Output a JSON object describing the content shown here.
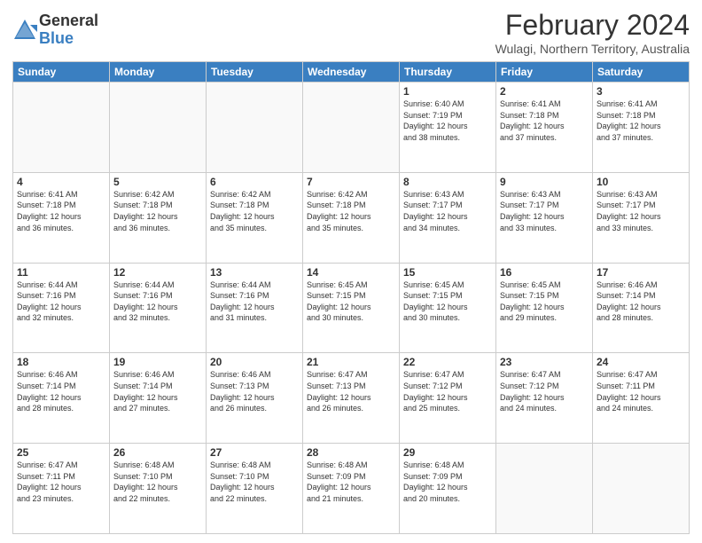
{
  "logo": {
    "general": "General",
    "blue": "Blue"
  },
  "title": "February 2024",
  "subtitle": "Wulagi, Northern Territory, Australia",
  "days_of_week": [
    "Sunday",
    "Monday",
    "Tuesday",
    "Wednesday",
    "Thursday",
    "Friday",
    "Saturday"
  ],
  "weeks": [
    [
      {
        "day": "",
        "info": ""
      },
      {
        "day": "",
        "info": ""
      },
      {
        "day": "",
        "info": ""
      },
      {
        "day": "",
        "info": ""
      },
      {
        "day": "1",
        "info": "Sunrise: 6:40 AM\nSunset: 7:19 PM\nDaylight: 12 hours\nand 38 minutes."
      },
      {
        "day": "2",
        "info": "Sunrise: 6:41 AM\nSunset: 7:18 PM\nDaylight: 12 hours\nand 37 minutes."
      },
      {
        "day": "3",
        "info": "Sunrise: 6:41 AM\nSunset: 7:18 PM\nDaylight: 12 hours\nand 37 minutes."
      }
    ],
    [
      {
        "day": "4",
        "info": "Sunrise: 6:41 AM\nSunset: 7:18 PM\nDaylight: 12 hours\nand 36 minutes."
      },
      {
        "day": "5",
        "info": "Sunrise: 6:42 AM\nSunset: 7:18 PM\nDaylight: 12 hours\nand 36 minutes."
      },
      {
        "day": "6",
        "info": "Sunrise: 6:42 AM\nSunset: 7:18 PM\nDaylight: 12 hours\nand 35 minutes."
      },
      {
        "day": "7",
        "info": "Sunrise: 6:42 AM\nSunset: 7:18 PM\nDaylight: 12 hours\nand 35 minutes."
      },
      {
        "day": "8",
        "info": "Sunrise: 6:43 AM\nSunset: 7:17 PM\nDaylight: 12 hours\nand 34 minutes."
      },
      {
        "day": "9",
        "info": "Sunrise: 6:43 AM\nSunset: 7:17 PM\nDaylight: 12 hours\nand 33 minutes."
      },
      {
        "day": "10",
        "info": "Sunrise: 6:43 AM\nSunset: 7:17 PM\nDaylight: 12 hours\nand 33 minutes."
      }
    ],
    [
      {
        "day": "11",
        "info": "Sunrise: 6:44 AM\nSunset: 7:16 PM\nDaylight: 12 hours\nand 32 minutes."
      },
      {
        "day": "12",
        "info": "Sunrise: 6:44 AM\nSunset: 7:16 PM\nDaylight: 12 hours\nand 32 minutes."
      },
      {
        "day": "13",
        "info": "Sunrise: 6:44 AM\nSunset: 7:16 PM\nDaylight: 12 hours\nand 31 minutes."
      },
      {
        "day": "14",
        "info": "Sunrise: 6:45 AM\nSunset: 7:15 PM\nDaylight: 12 hours\nand 30 minutes."
      },
      {
        "day": "15",
        "info": "Sunrise: 6:45 AM\nSunset: 7:15 PM\nDaylight: 12 hours\nand 30 minutes."
      },
      {
        "day": "16",
        "info": "Sunrise: 6:45 AM\nSunset: 7:15 PM\nDaylight: 12 hours\nand 29 minutes."
      },
      {
        "day": "17",
        "info": "Sunrise: 6:46 AM\nSunset: 7:14 PM\nDaylight: 12 hours\nand 28 minutes."
      }
    ],
    [
      {
        "day": "18",
        "info": "Sunrise: 6:46 AM\nSunset: 7:14 PM\nDaylight: 12 hours\nand 28 minutes."
      },
      {
        "day": "19",
        "info": "Sunrise: 6:46 AM\nSunset: 7:14 PM\nDaylight: 12 hours\nand 27 minutes."
      },
      {
        "day": "20",
        "info": "Sunrise: 6:46 AM\nSunset: 7:13 PM\nDaylight: 12 hours\nand 26 minutes."
      },
      {
        "day": "21",
        "info": "Sunrise: 6:47 AM\nSunset: 7:13 PM\nDaylight: 12 hours\nand 26 minutes."
      },
      {
        "day": "22",
        "info": "Sunrise: 6:47 AM\nSunset: 7:12 PM\nDaylight: 12 hours\nand 25 minutes."
      },
      {
        "day": "23",
        "info": "Sunrise: 6:47 AM\nSunset: 7:12 PM\nDaylight: 12 hours\nand 24 minutes."
      },
      {
        "day": "24",
        "info": "Sunrise: 6:47 AM\nSunset: 7:11 PM\nDaylight: 12 hours\nand 24 minutes."
      }
    ],
    [
      {
        "day": "25",
        "info": "Sunrise: 6:47 AM\nSunset: 7:11 PM\nDaylight: 12 hours\nand 23 minutes."
      },
      {
        "day": "26",
        "info": "Sunrise: 6:48 AM\nSunset: 7:10 PM\nDaylight: 12 hours\nand 22 minutes."
      },
      {
        "day": "27",
        "info": "Sunrise: 6:48 AM\nSunset: 7:10 PM\nDaylight: 12 hours\nand 22 minutes."
      },
      {
        "day": "28",
        "info": "Sunrise: 6:48 AM\nSunset: 7:09 PM\nDaylight: 12 hours\nand 21 minutes."
      },
      {
        "day": "29",
        "info": "Sunrise: 6:48 AM\nSunset: 7:09 PM\nDaylight: 12 hours\nand 20 minutes."
      },
      {
        "day": "",
        "info": ""
      },
      {
        "day": "",
        "info": ""
      }
    ]
  ]
}
